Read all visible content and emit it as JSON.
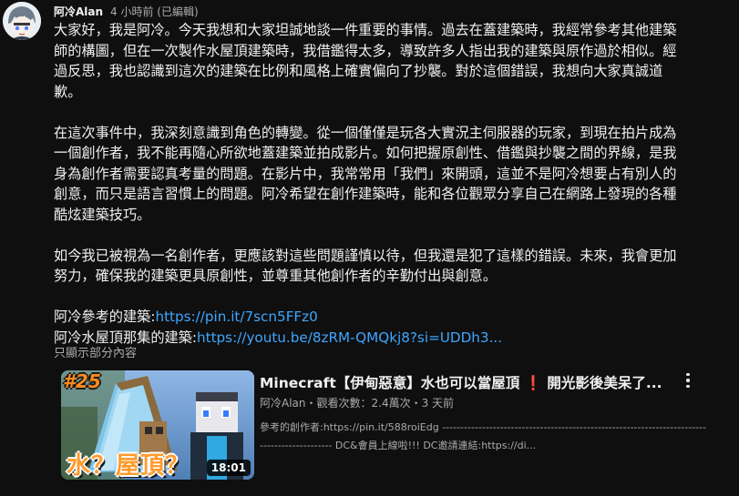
{
  "post": {
    "author": "阿冷Alan",
    "timestamp": "4 小時前 (已編輯)",
    "avatar_icon": "avatar-chibi-icon",
    "paragraphs": [
      [
        "大家好，我是阿冷。今天我想和大家坦誠地談一件重要的事情。過去在蓋建築時，我經常參考其他建築",
        "師的構圖，但在一次製作水屋頂建築時，我借鑑得太多，導致許多人指出我的建築與原作過於相似。經",
        "過反思，我也認識到這次的建築在比例和風格上確實偏向了抄襲。對於這個錯誤，我想向大家真誠道",
        "歉。"
      ],
      [
        "在這次事件中，我深刻意識到角色的轉變。從一個僅僅是玩各大實況主伺服器的玩家，到現在拍片成為",
        "一個創作者，我不能再隨心所欲地蓋建築並拍成影片。如何把握原創性、借鑑與抄襲之間的界線，是我",
        "身為創作者需要認真考量的問題。在影片中，我常常用「我們」來開頭，這並不是阿冷想要占有別人的",
        "創意，而只是語言習慣上的問題。阿冷希望在創作建築時，能和各位觀眾分享自己在網路上發現的各種",
        "酷炫建築技巧。"
      ],
      [
        "如今我已被視為一名創作者，更應該對這些問題謹慎以待，但我還是犯了這樣的錯誤。未來，我會更加",
        "努力，確保我的建築更具原創性，並尊重其他創作者的辛勤付出與創意。"
      ]
    ],
    "link1_label": "阿冷參考的建築:",
    "link1_url": "https://pin.it/7scn5FFz0",
    "link2_label": "阿冷水屋頂那集的建築:",
    "link2_url": "https://youtu.be/8zRM-QMQkj8?si=UDDh3...",
    "show_less": "只顯示部分內容"
  },
  "video": {
    "episode_badge": "#25",
    "thumb_title": "水？屋頂？",
    "duration": "18:01",
    "title_main": "Minecraft【伊甸惡意】水也可以當屋頂",
    "title_warn": "❗",
    "title_end": "開光影後美呆了...",
    "meta": "阿冷Alan・觀看次數：2.4萬次・3 天前",
    "desc_line1": "參考的創作者:https://pin.it/588roiEdg --------------------------------------------------------------------------------------------",
    "desc_line2": "-------------------- DC&會員上線啦!!! DC邀請連結:https://di...",
    "more_icon": "more-vert-icon"
  }
}
